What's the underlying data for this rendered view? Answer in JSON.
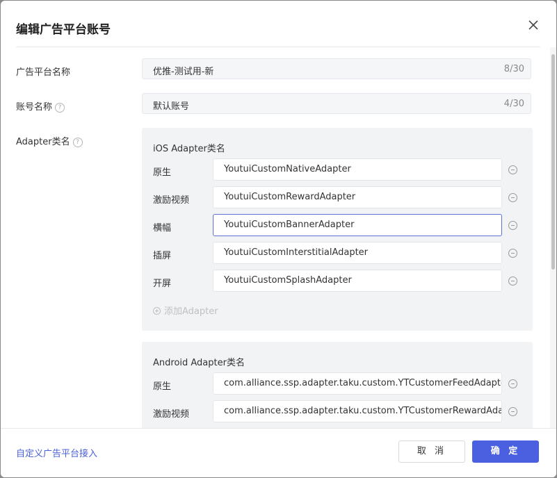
{
  "dialog": {
    "title": "编辑广告平台账号"
  },
  "fields": {
    "platform_name": {
      "label": "广告平台名称",
      "value": "优推-测试用-新",
      "count": "8/30"
    },
    "account_name": {
      "label": "账号名称",
      "value": "默认账号",
      "count": "4/30"
    },
    "adapter_label": "Adapter类名"
  },
  "ios": {
    "title": "iOS Adapter类名",
    "rows": [
      {
        "label": "原生",
        "value": "YoutuiCustomNativeAdapter"
      },
      {
        "label": "激励视频",
        "value": "YoutuiCustomRewardAdapter"
      },
      {
        "label": "横幅",
        "value": "YoutuiCustomBannerAdapter"
      },
      {
        "label": "插屏",
        "value": "YoutuiCustomInterstitialAdapter"
      },
      {
        "label": "开屏",
        "value": "YoutuiCustomSplashAdapter"
      }
    ],
    "add_label": "添加Adapter"
  },
  "android": {
    "title": "Android Adapter类名",
    "rows": [
      {
        "label": "原生",
        "value": "com.alliance.ssp.adapter.taku.custom.YTCustomerFeedAdapter"
      },
      {
        "label": "激励视频",
        "value": "com.alliance.ssp.adapter.taku.custom.YTCustomerRewardAdapter"
      }
    ]
  },
  "footer": {
    "link": "自定义广告平台接入",
    "cancel": "取 消",
    "confirm": "确 定"
  },
  "colors": {
    "primary": "#4a60e0",
    "link": "#4a60d6",
    "group_bg": "#f2f3f5"
  }
}
